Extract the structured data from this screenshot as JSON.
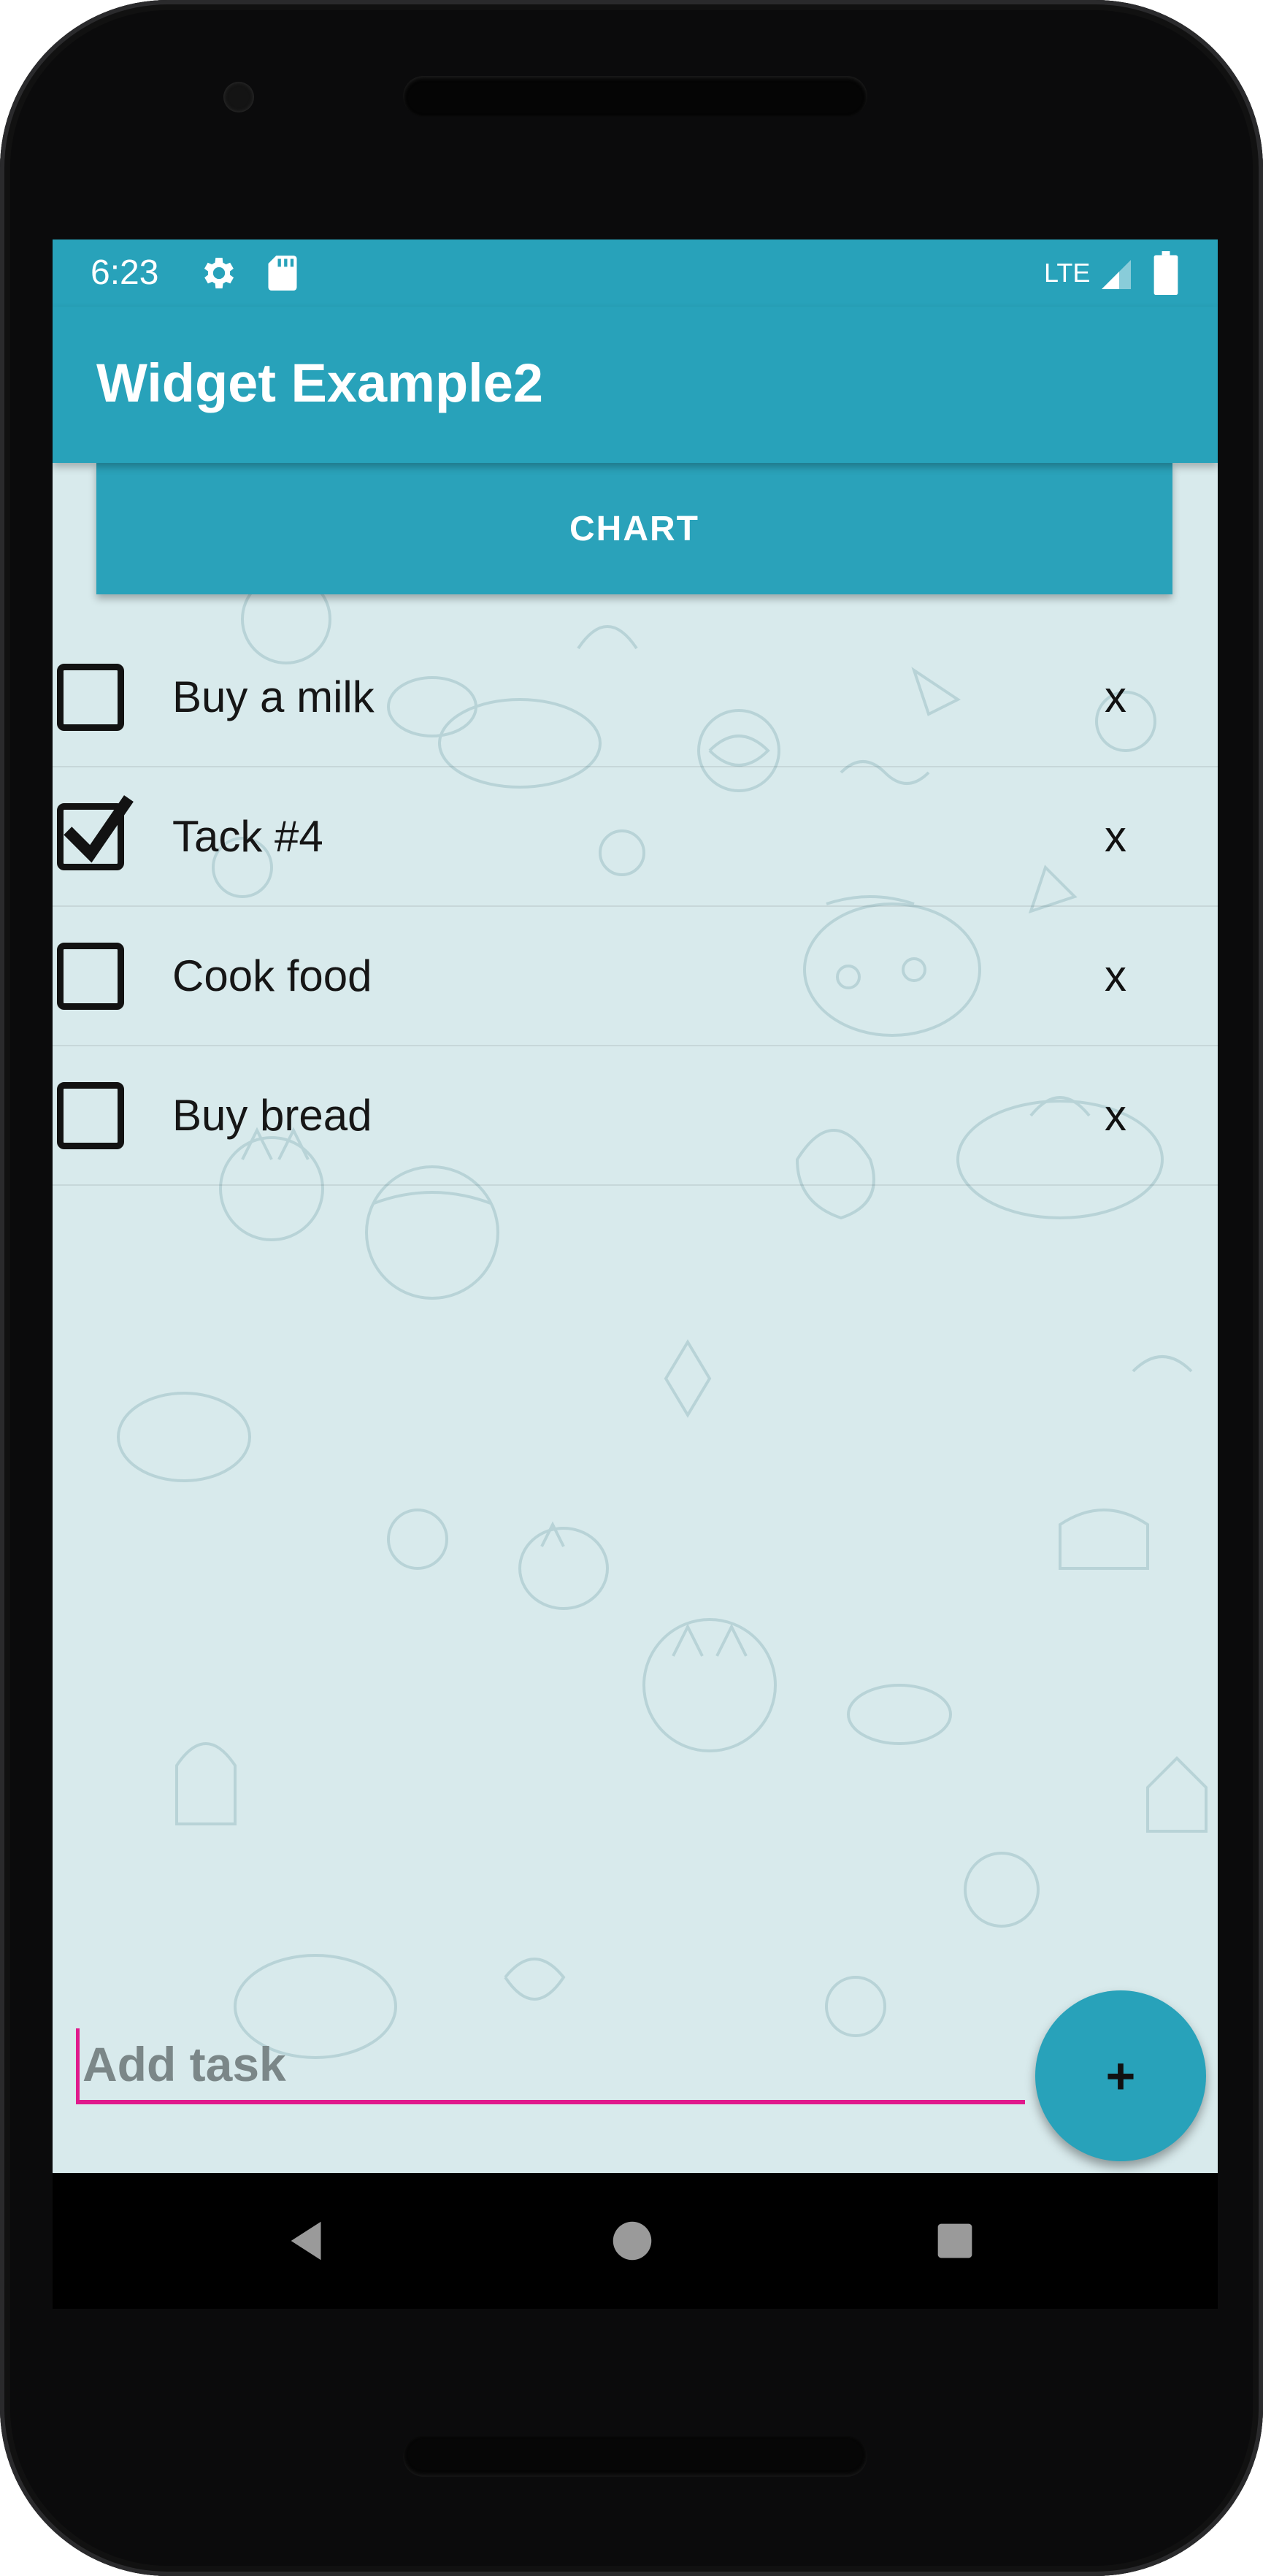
{
  "status_bar": {
    "time": "6:23",
    "network": "LTE",
    "icons": [
      "gear-icon",
      "sd-card-icon",
      "signal-icon",
      "battery-icon"
    ]
  },
  "app_bar": {
    "title": "Widget Example2"
  },
  "chart_button": {
    "label": "CHART"
  },
  "tasks": [
    {
      "label": "Buy a milk",
      "checked": false,
      "delete_label": "x"
    },
    {
      "label": "Tack #4",
      "checked": true,
      "delete_label": "x"
    },
    {
      "label": "Cook food",
      "checked": false,
      "delete_label": "x"
    },
    {
      "label": "Buy bread",
      "checked": false,
      "delete_label": "x"
    }
  ],
  "add_task": {
    "placeholder": "Add task",
    "value": ""
  },
  "fab": {
    "label": "+"
  },
  "nav_bar": {
    "icons": [
      "back-icon",
      "home-icon",
      "recents-icon"
    ]
  },
  "colors": {
    "primary": "#28a2ba",
    "background": "#d8eaec",
    "input_accent": "#e01a8c",
    "text": "#161616"
  }
}
